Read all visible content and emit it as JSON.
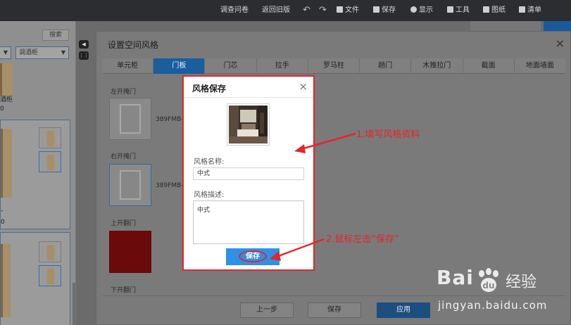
{
  "toolbar": {
    "survey": "调查问卷",
    "old_version": "返回旧版",
    "file": "文件",
    "save": "保存",
    "display": "显示",
    "tools": "工具",
    "drawings": "图纸",
    "list": "清单"
  },
  "left_panel": {
    "search": "搜索",
    "filter": "调酒柜",
    "item1_name": "酒柜",
    "item1_value": "0",
    "item2_value": "0"
  },
  "dialog": {
    "title": "设置空间风格",
    "tabs": [
      "单元柜",
      "门板",
      "门芯",
      "拉手",
      "罗马柱",
      "趟门",
      "木推拉门",
      "截面",
      "地面墙面"
    ],
    "active_tab": 1,
    "groups": {
      "left_door": "左开掩门",
      "right_door": "右开掩门",
      "up_door": "上开翻门",
      "down_door": "下开翻门"
    },
    "door_code_1": "389FMB-",
    "door_code_2": "389FMB-",
    "buttons": {
      "prev": "上一步",
      "save": "保存",
      "apply": "应用"
    }
  },
  "modal": {
    "title": "风格保存",
    "name_label": "风格名称:",
    "name_value": "中式",
    "desc_label": "风格描述:",
    "desc_value": "中式",
    "save_label": "保存"
  },
  "annotations": {
    "step1": "1.填写风格资料",
    "step2": "2.鼠标左击“保存”"
  },
  "watermark": {
    "brand": "Bai",
    "cn": "经验",
    "url": "jingyan.baidu.com"
  },
  "colors": {
    "accent_red": "#e3262a",
    "save_blue": "#2f91e6",
    "tab_active": "#1a5e9e"
  }
}
